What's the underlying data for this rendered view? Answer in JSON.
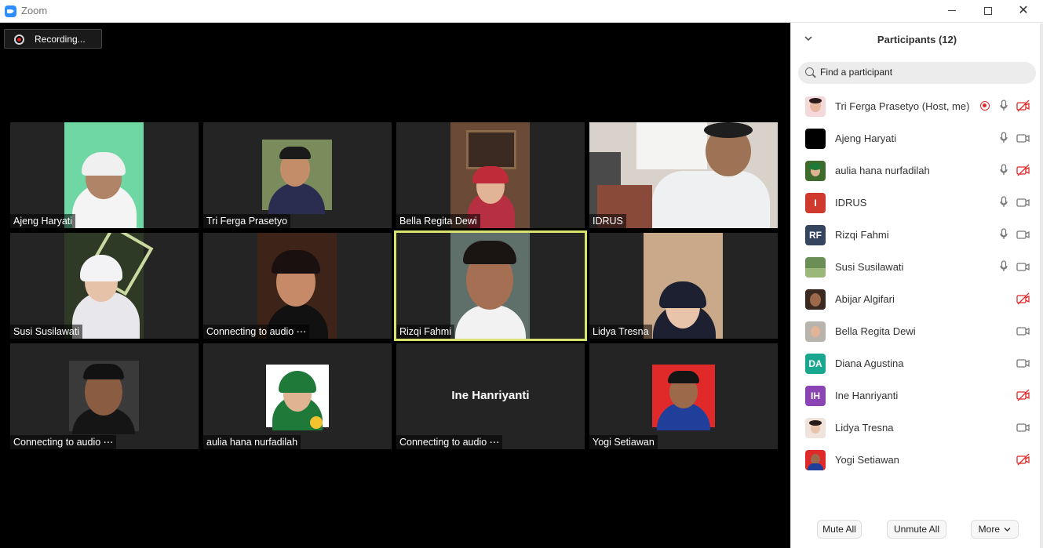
{
  "window": {
    "title": "Zoom"
  },
  "recording": {
    "label": "Recording..."
  },
  "tiles": [
    {
      "name": "Ajeng Haryati"
    },
    {
      "name": "Tri Ferga Prasetyo"
    },
    {
      "name": "Bella Regita Dewi"
    },
    {
      "name": "IDRUS"
    },
    {
      "name": "Susi Susilawati"
    },
    {
      "name": "Connecting to audio ⋯"
    },
    {
      "name": "Rizqi Fahmi"
    },
    {
      "name": "Lidya Tresna"
    },
    {
      "name": "Connecting to audio ⋯"
    },
    {
      "name": "aulia hana nurfadilah"
    },
    {
      "name": "Connecting to audio ⋯",
      "display_name": "Ine Hanriyanti"
    },
    {
      "name": "Yogi Setiawan"
    }
  ],
  "participants_panel": {
    "title": "Participants (12)",
    "search_placeholder": "Find a participant",
    "participants": [
      {
        "name": "Tri Ferga Prasetyo (Host, me)",
        "avatar": "photo",
        "recording": true,
        "mic": "on",
        "video": "off"
      },
      {
        "name": "Ajeng Haryati",
        "avatar": "photo",
        "mic": "on",
        "video": "on"
      },
      {
        "name": "aulia hana nurfadilah",
        "avatar": "photo",
        "mic": "on",
        "video": "off"
      },
      {
        "name": "IDRUS",
        "avatar_initials": "I",
        "avatar_color": "#d0392e",
        "mic": "on",
        "video": "on"
      },
      {
        "name": "Rizqi Fahmi",
        "avatar_initials": "RF",
        "avatar_color": "#36455e",
        "mic": "on",
        "video": "on"
      },
      {
        "name": "Susi Susilawati",
        "avatar": "photo",
        "mic": "on",
        "video": "on"
      },
      {
        "name": "Abijar Algifari",
        "avatar": "photo",
        "video": "off"
      },
      {
        "name": "Bella Regita Dewi",
        "avatar": "photo",
        "video": "on"
      },
      {
        "name": "Diana Agustina",
        "avatar_initials": "DA",
        "avatar_color": "#1aa78f",
        "video": "on"
      },
      {
        "name": "Ine Hanriyanti",
        "avatar_initials": "IH",
        "avatar_color": "#8b44b4",
        "video": "off"
      },
      {
        "name": "Lidya Tresna",
        "avatar": "photo",
        "video": "on"
      },
      {
        "name": "Yogi Setiawan",
        "avatar": "photo",
        "video": "off"
      }
    ],
    "buttons": {
      "mute_all": "Mute All",
      "unmute_all": "Unmute All",
      "more": "More"
    }
  },
  "colors": {
    "active_speaker_border": "#d7e36d",
    "muted_video_red": "#e02828",
    "zoom_blue": "#2D8CFF"
  }
}
